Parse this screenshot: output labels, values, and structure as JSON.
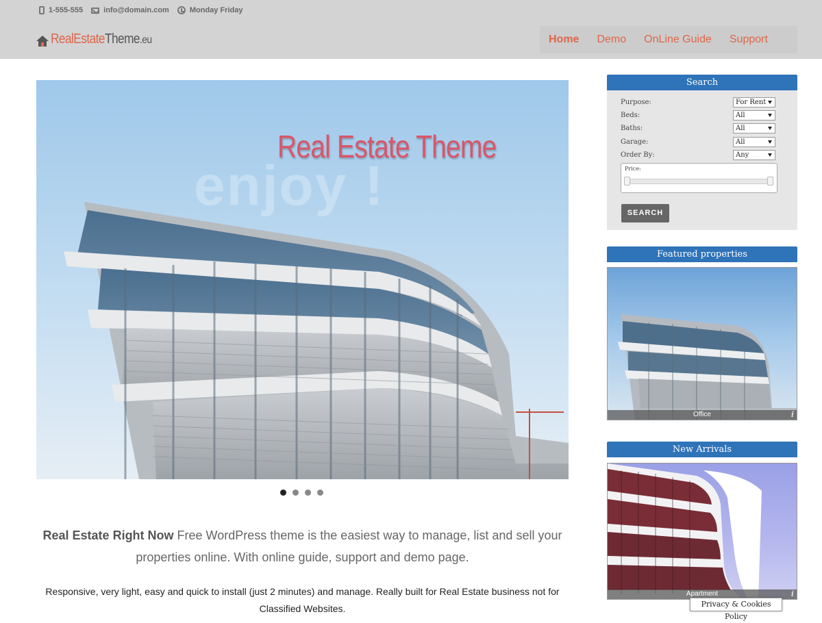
{
  "topbar": {
    "phone": "1-555-555",
    "email": "info@domain.com",
    "hours": "Monday Friday"
  },
  "logo": {
    "part1": "Real",
    "part2": "Estate",
    "part3": "Theme",
    "part4": ".eu"
  },
  "nav": {
    "items": [
      {
        "label": "Home",
        "active": true
      },
      {
        "label": "Demo"
      },
      {
        "label": "OnLine Guide"
      },
      {
        "label": "Support"
      }
    ]
  },
  "slider": {
    "caption": "Real Estate Theme",
    "watermark": "enjoy !",
    "slide_count": 4,
    "active_slide": 1
  },
  "intro": {
    "lead_bold": "Real Estate Right Now",
    "lead_text": " Free WordPress theme is the easiest way to manage, list and sell your properties online. With online guide, support and demo page.",
    "body": "Responsive, very light, easy and quick  to install (just 2 minutes)  and manage. Really built for Real Estate business not for Classified Websites."
  },
  "search_widget": {
    "title": "Search",
    "fields": [
      {
        "label": "Purpose:",
        "value": "For Rent"
      },
      {
        "label": "Beds:",
        "value": "All"
      },
      {
        "label": "Baths:",
        "value": "All"
      },
      {
        "label": "Garage:",
        "value": "All"
      },
      {
        "label": "Order By:",
        "value": "Any"
      }
    ],
    "price_label": "Price:",
    "button": "SEARCH"
  },
  "featured_widget": {
    "title": "Featured properties",
    "item_label": "Office"
  },
  "arrivals_widget": {
    "title": "New Arrivals",
    "item_label": "Apartment"
  },
  "cookie": {
    "label": "Privacy & Cookies Policy"
  },
  "colors": {
    "accent": "#e0654a",
    "widget_header": "#2f73b8",
    "header_bg": "#d3d3d3"
  }
}
